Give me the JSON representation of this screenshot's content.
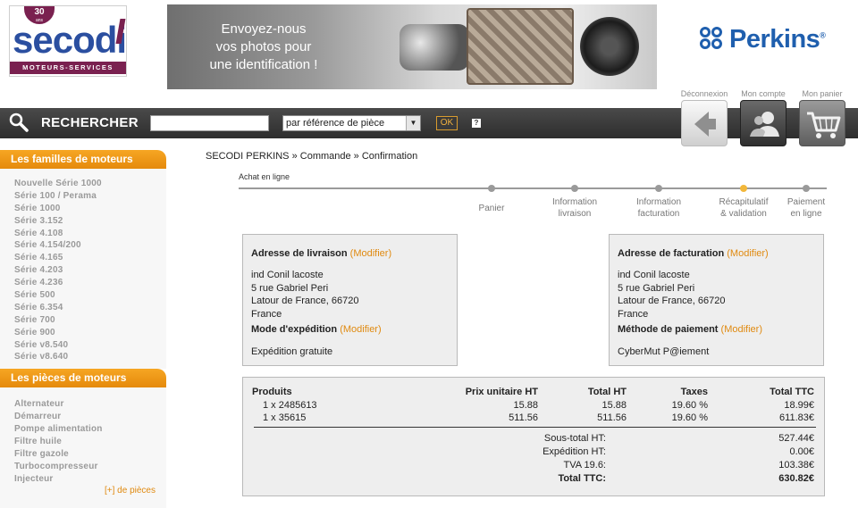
{
  "logo": {
    "badge_number": "30",
    "badge_sub": "ans",
    "name": "secodi",
    "tagline": "MOTEURS-SERVICES"
  },
  "banner": {
    "line1": "Envoyez-nous",
    "line2": "vos photos pour",
    "line3": "une identification !"
  },
  "brand": {
    "name": "Perkins",
    "mark": "®"
  },
  "search": {
    "label": "RECHERCHER",
    "input_value": "",
    "select_value": "par référence de pièce",
    "ok_label": "OK",
    "help_label": "?"
  },
  "top_links": {
    "logout": "Déconnexion",
    "account": "Mon compte",
    "cart": "Mon panier"
  },
  "sidebar": {
    "engines_title": "Les familles de moteurs",
    "engines": [
      "Nouvelle Série 1000",
      "Série 100 / Perama",
      "Série 1000",
      "Série 3.152",
      "Série 4.108",
      "Série 4.154/200",
      "Série 4.165",
      "Série 4.203",
      "Série 4.236",
      "Série 500",
      "Série 6.354",
      "Série 700",
      "Série 900",
      "Série v8.540",
      "Série v8.640"
    ],
    "parts_title": "Les pièces de moteurs",
    "parts": [
      "Alternateur",
      "Démarreur",
      "Pompe alimentation",
      "Filtre huile",
      "Filtre gazole",
      "Turbocompresseur",
      "Injecteur"
    ],
    "more_parts": "[+] de pièces"
  },
  "breadcrumb": "SECODI PERKINS » Commande » Confirmation",
  "steps": {
    "title": "Achat en ligne",
    "items": [
      {
        "line1": "Panier",
        "line2": ""
      },
      {
        "line1": "Information",
        "line2": "livraison"
      },
      {
        "line1": "Information",
        "line2": "facturation"
      },
      {
        "line1": "Récapitulatif",
        "line2": "& validation"
      },
      {
        "line1": "Paiement",
        "line2": "en ligne"
      }
    ],
    "active_index": 3
  },
  "delivery": {
    "title": "Adresse de livraison",
    "modify": "(Modifier)",
    "name": "ind Conil lacoste",
    "street": "5 rue Gabriel Peri",
    "city": "Latour de France, 66720",
    "country": "France",
    "shipping_title": "Mode d'expédition",
    "shipping_modify": "(Modifier)",
    "shipping_value": "Expédition gratuite"
  },
  "billing": {
    "title": "Adresse de facturation",
    "modify": "(Modifier)",
    "name": "ind Conil lacoste",
    "street": "5 rue Gabriel Peri",
    "city": "Latour de France, 66720",
    "country": "France",
    "payment_title": "Méthode de paiement",
    "payment_modify": "(Modifier)",
    "payment_value": "CyberMut P@iement"
  },
  "order": {
    "headers": {
      "products": "Produits",
      "unit_price": "Prix unitaire HT",
      "total_ht": "Total HT",
      "taxes": "Taxes",
      "total_ttc": "Total TTC"
    },
    "rows": [
      {
        "product": "1 x 2485613",
        "unit_price": "15.88",
        "total_ht": "15.88",
        "tax": "19.60 %",
        "total_ttc": "18.99€"
      },
      {
        "product": "1 x 35615",
        "unit_price": "511.56",
        "total_ht": "511.56",
        "tax": "19.60 %",
        "total_ttc": "611.83€"
      }
    ],
    "summary": [
      {
        "label": "Sous-total HT:",
        "value": "527.44€"
      },
      {
        "label": "Expédition HT:",
        "value": "0.00€"
      },
      {
        "label": "TVA 19.6:",
        "value": "103.38€"
      },
      {
        "label": "Total TTC:",
        "value": "630.82€"
      }
    ]
  }
}
